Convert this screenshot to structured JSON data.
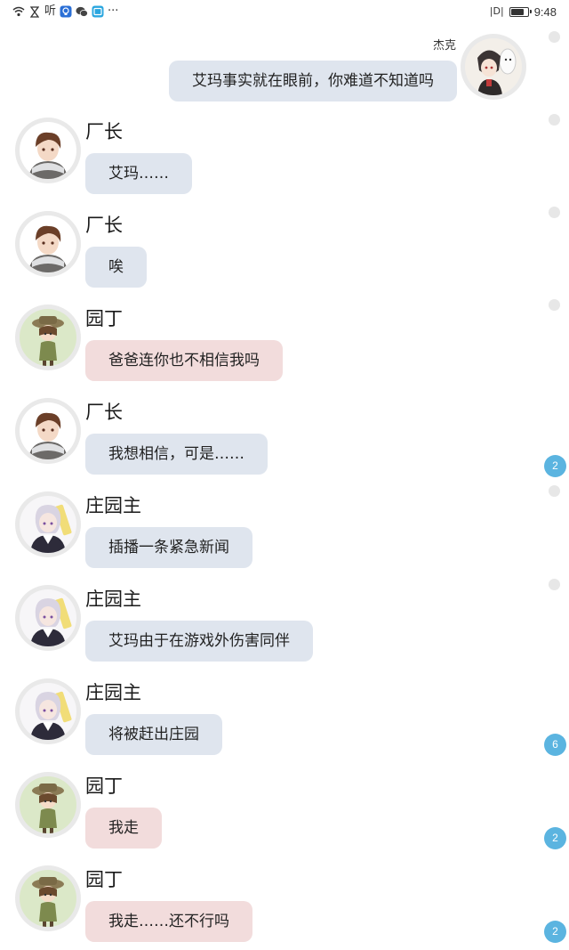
{
  "status_bar": {
    "icons_left": [
      "wifi-icon",
      "hourglass-icon",
      "ting-text",
      "lightbulb-icon",
      "wechat-icon",
      "tablet-icon",
      "more-dots"
    ],
    "ting_label": "听",
    "more_label": "···",
    "vibrate_label": "|D|",
    "time": "9:48",
    "battery_level": 0.8
  },
  "messages": [
    {
      "side": "right",
      "name": "杰克",
      "text": "艾玛事实就在眼前，你难道不知道吗",
      "avatar": "jack-avatar",
      "color": "blue"
    },
    {
      "side": "left",
      "name": "厂长",
      "text": "艾玛……",
      "avatar": "factory-director-avatar",
      "color": "blue"
    },
    {
      "side": "left",
      "name": "厂长",
      "text": "唉",
      "avatar": "factory-director-avatar",
      "color": "blue"
    },
    {
      "side": "left",
      "name": "园丁",
      "text": "爸爸连你也不相信我吗",
      "avatar": "gardener-avatar",
      "color": "pink"
    },
    {
      "side": "left",
      "name": "厂长",
      "text": "我想相信，可是……",
      "avatar": "factory-director-avatar",
      "color": "blue",
      "badge": "2"
    },
    {
      "side": "left",
      "name": "庄园主",
      "text": "插播一条紧急新闻",
      "avatar": "manor-owner-avatar",
      "color": "blue"
    },
    {
      "side": "left",
      "name": "庄园主",
      "text": "艾玛由于在游戏外伤害同伴",
      "avatar": "manor-owner-avatar",
      "color": "blue"
    },
    {
      "side": "left",
      "name": "庄园主",
      "text": "将被赶出庄园",
      "avatar": "manor-owner-avatar",
      "color": "blue",
      "badge": "6"
    },
    {
      "side": "left",
      "name": "园丁",
      "text": "我走",
      "avatar": "gardener-avatar",
      "color": "pink",
      "badge": "2"
    },
    {
      "side": "left",
      "name": "园丁",
      "text": "我走……还不行吗",
      "avatar": "gardener-avatar",
      "color": "pink",
      "badge": "2"
    }
  ],
  "colors": {
    "bubble_blue": "#dfe5ee",
    "bubble_pink": "#f2dcdc",
    "badge": "#5bb4e0"
  }
}
